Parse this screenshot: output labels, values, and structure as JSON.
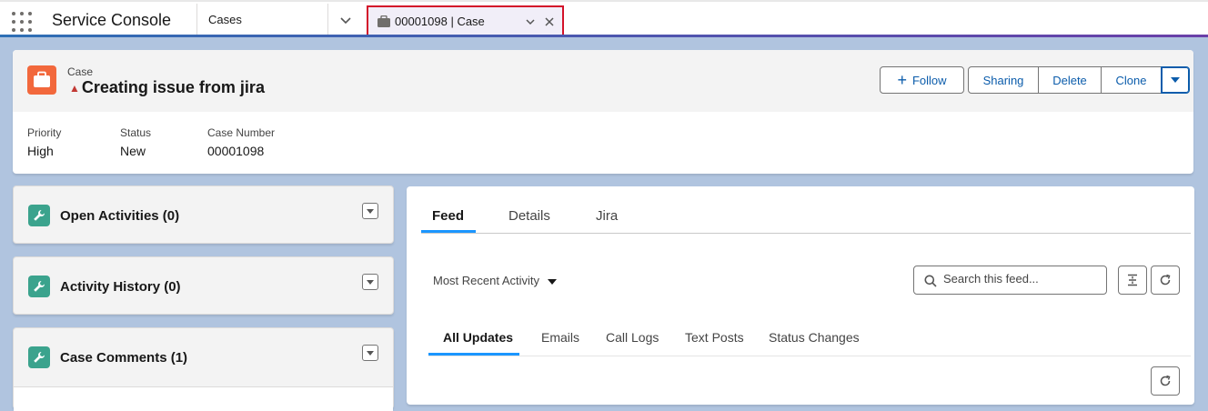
{
  "app": {
    "name": "Service Console"
  },
  "nav": {
    "item": "Cases"
  },
  "workspace_tab": {
    "label": "00001098 | Case"
  },
  "record": {
    "object_type": "Case",
    "title": "Creating issue from jira",
    "actions": {
      "follow": "Follow",
      "sharing": "Sharing",
      "delete": "Delete",
      "clone": "Clone"
    },
    "fields": [
      {
        "label": "Priority",
        "value": "High"
      },
      {
        "label": "Status",
        "value": "New"
      },
      {
        "label": "Case Number",
        "value": "00001098"
      }
    ]
  },
  "related": [
    {
      "title": "Open Activities (0)"
    },
    {
      "title": "Activity History (0)"
    },
    {
      "title": "Case Comments (1)"
    }
  ],
  "tabs": [
    "Feed",
    "Details",
    "Jira"
  ],
  "feed": {
    "filter": "Most Recent Activity",
    "search_placeholder": "Search this feed...",
    "subtabs": [
      "All Updates",
      "Emails",
      "Call Logs",
      "Text Posts",
      "Status Changes"
    ]
  },
  "colors": {
    "brand": "#0b5cab",
    "case_icon": "#f2683c",
    "related_icon": "#3ba38d",
    "active_tab_border": "#d3122a",
    "tab_underline": "#1b96ff"
  }
}
